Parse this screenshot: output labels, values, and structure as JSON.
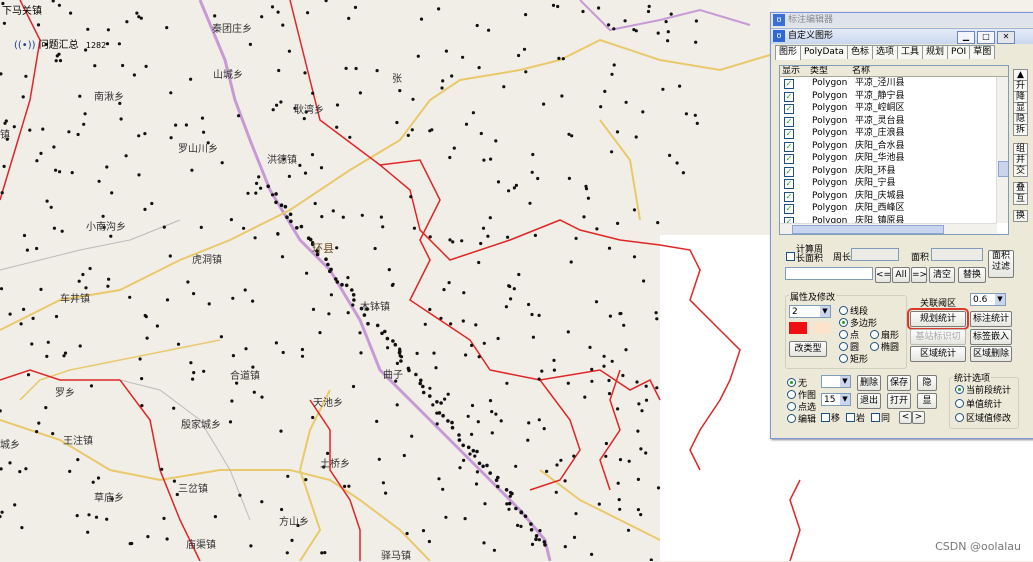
{
  "map": {
    "top_labels": [
      "下马关镇",
      "问题汇总",
      "1282"
    ],
    "place_labels": [
      {
        "text": "秦团庄乡"
      },
      {
        "text": "山城乡"
      },
      {
        "text": "南湫乡"
      },
      {
        "text": "张"
      },
      {
        "text": "耿湾乡"
      },
      {
        "text": "罗山川乡"
      },
      {
        "text": "洪德镇"
      },
      {
        "text": "小南沟乡"
      },
      {
        "text": "环县"
      },
      {
        "text": "虎洞镇"
      },
      {
        "text": "车井镇"
      },
      {
        "text": "木钵镇"
      },
      {
        "text": "合道镇"
      },
      {
        "text": "曲子"
      },
      {
        "text": "罗乡"
      },
      {
        "text": "天池乡"
      },
      {
        "text": "殷家城乡"
      },
      {
        "text": "王注镇"
      },
      {
        "text": "土桥乡"
      },
      {
        "text": "草庙乡"
      },
      {
        "text": "三岔镇"
      },
      {
        "text": "方山乡"
      },
      {
        "text": "庙渠镇"
      },
      {
        "text": "驿马镇"
      },
      {
        "text": "城乡"
      },
      {
        "text": "镇"
      }
    ],
    "watermark": "CSDN @oolalau"
  },
  "dialog": {
    "ghost_title": "标注编辑器",
    "title": "自定义图形",
    "tabs": [
      "图形",
      "PolyData",
      "色标",
      "选项",
      "工具",
      "规划",
      "POI",
      "草图"
    ],
    "columns": [
      "显示",
      "类型",
      "名称"
    ],
    "rows": [
      {
        "type": "Polygon",
        "name": "平凉_泾川县"
      },
      {
        "type": "Polygon",
        "name": "平凉_静宁县"
      },
      {
        "type": "Polygon",
        "name": "平凉_崆峒区"
      },
      {
        "type": "Polygon",
        "name": "平凉_灵台县"
      },
      {
        "type": "Polygon",
        "name": "平凉_庄浪县"
      },
      {
        "type": "Polygon",
        "name": "庆阳_合水县"
      },
      {
        "type": "Polygon",
        "name": "庆阳_华池县"
      },
      {
        "type": "Polygon",
        "name": "庆阳_环县"
      },
      {
        "type": "Polygon",
        "name": "庆阳_宁县"
      },
      {
        "type": "Polygon",
        "name": "庆阳_庆城县"
      },
      {
        "type": "Polygon",
        "name": "庆阳_西峰区"
      },
      {
        "type": "Polygon",
        "name": "庆阳_镇原县"
      }
    ],
    "side_buttons": [
      "▲",
      "升",
      "降",
      "显",
      "隐",
      "拆",
      "组",
      "并",
      "交",
      "叠",
      "互",
      "换"
    ],
    "calc": {
      "checkbox_label": "计算周长面积",
      "perimeter_label": "周长",
      "area_label": "面积",
      "filter_btn": "面积过滤",
      "lt_btn": "<=",
      "all_btn": "All",
      "gt_btn": "=>",
      "clear_btn": "清空",
      "replace_btn": "替换"
    },
    "attr": {
      "group_label": "属性及修改",
      "width_value": "2",
      "shape_options": [
        "线段",
        "多边形",
        "点",
        "圆",
        "矩形",
        "扇形",
        "椭圆"
      ],
      "change_type_btn": "改类型",
      "fill_color": "#f01010",
      "fill_color2": "#fde2cc"
    },
    "stats": {
      "assoc_label": "关联阈区",
      "threshold": "0.6",
      "region_stats_btn": "规划统计",
      "mark_stats_btn": "标注统计",
      "region_mark_btn": "基站标识切",
      "mark_embed_btn": "标签嵌入",
      "area_stats_btn": "区域统计",
      "area_delete_btn": "区域删除"
    },
    "bottom": {
      "radios": [
        "无",
        "作图",
        "点选",
        "编辑"
      ],
      "delete_btn": "删除",
      "save_btn": "保存",
      "hide_btn": "隐",
      "exit_btn": "退出",
      "open_btn": "打开",
      "show_btn": "显",
      "size_value": "15",
      "checks": [
        "移",
        "岩",
        "同"
      ],
      "prev_btn": "<",
      "next_btn": ">"
    },
    "stat_options": {
      "label": "统计选项",
      "opts": [
        "当前段统计",
        "单值统计",
        "区域值修改"
      ]
    }
  }
}
